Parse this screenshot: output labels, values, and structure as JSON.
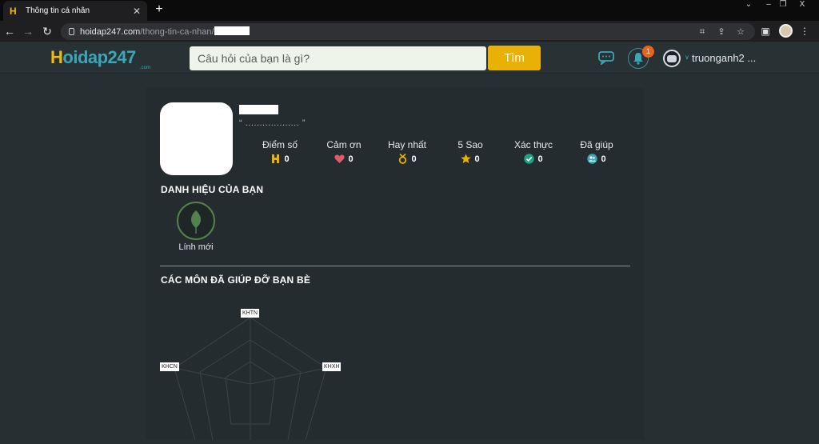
{
  "browser": {
    "tab_title": "Thông tin cá nhân",
    "new_tab": "+",
    "url_host": "hoidap247.com",
    "url_path": "/thong-tin-ca-nhan/",
    "window_controls": {
      "minimize": "–",
      "restore": "❐",
      "close": "X"
    },
    "chevron": "⌄"
  },
  "header": {
    "logo_prefix": "H",
    "logo_main": "oidap247",
    "logo_sub": ".com",
    "search_placeholder": "Câu hỏi của bạn là gì?",
    "search_button": "Tìm",
    "notification_count": "1",
    "username": "truonganh2 ..."
  },
  "profile": {
    "quote": "“ ................... ”",
    "stats": [
      {
        "label": "Điểm số",
        "value": "0",
        "icon": "h-logo-icon",
        "color": "#e9b106"
      },
      {
        "label": "Cảm ơn",
        "value": "0",
        "icon": "heart-icon",
        "color": "#e05a6d"
      },
      {
        "label": "Hay nhất",
        "value": "0",
        "icon": "medal-icon",
        "color": "#e9b106"
      },
      {
        "label": "5 Sao",
        "value": "0",
        "icon": "star-icon",
        "color": "#e9b106"
      },
      {
        "label": "Xác thực",
        "value": "0",
        "icon": "check-circle-icon",
        "color": "#1fa37a"
      },
      {
        "label": "Đã giúp",
        "value": "0",
        "icon": "users-icon",
        "color": "#3aa6b9"
      }
    ]
  },
  "titles": {
    "heading": "DANH HIỆU CỦA BẠN",
    "badge_label": "Lính mới"
  },
  "subjects": {
    "heading": "CÁC MÔN ĐÃ GIÚP ĐỠ BẠN BÈ",
    "radar_labels": {
      "top": "KHTN",
      "left": "KHCN",
      "right": "KHXH"
    }
  },
  "colors": {
    "accent_yellow": "#e9b106",
    "accent_teal": "#3aa6b9",
    "page_bg": "#263033",
    "card_bg": "#242c2f",
    "badge_green": "#55814d"
  }
}
